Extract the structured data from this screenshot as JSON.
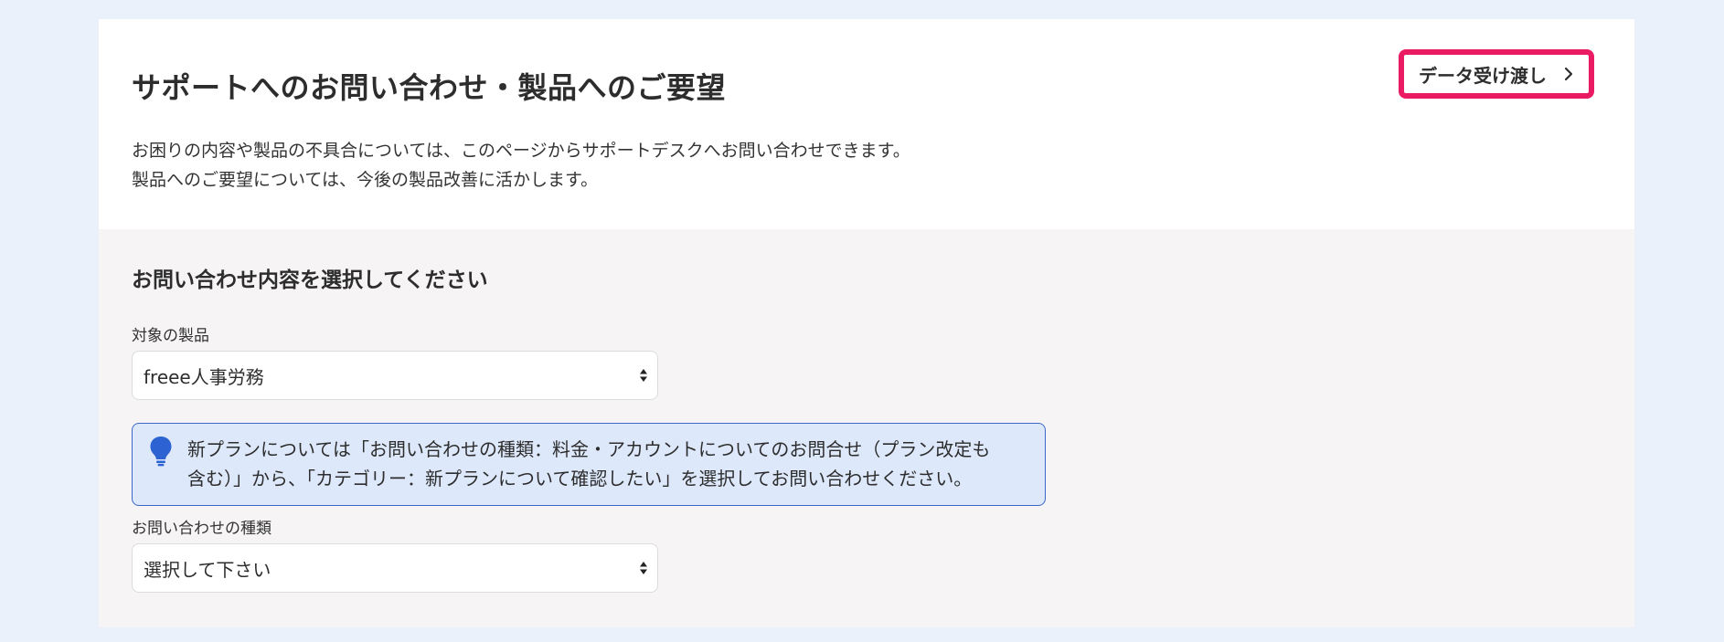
{
  "header": {
    "title": "サポートへのお問い合わせ・製品へのご要望",
    "handoff_button_label": "データ受け渡し",
    "intro_lines": [
      "お困りの内容や製品の不具合については、このページからサポートデスクへお問い合わせできます。",
      "製品へのご要望については、今後の製品改善に活かします。"
    ]
  },
  "form": {
    "section_title": "お問い合わせ内容を選択してください",
    "product": {
      "label": "対象の製品",
      "value": "freee人事労務"
    },
    "notice": {
      "icon": "lightbulb-icon",
      "lines": [
        "新プランについては「お問い合わせの種類：料金・アカウントについてのお問合せ（プラン改定も",
        "含む）」から、「カテゴリー：新プランについて確認したい」を選択してお問い合わせください。"
      ]
    },
    "inquiry_type": {
      "label": "お問い合わせの種類",
      "value": "選択して下さい"
    }
  },
  "colors": {
    "page_background": "#eaf1fb",
    "form_background": "#f6f4f4",
    "highlight_border": "#eb1b63",
    "notice_background": "#dde8fb",
    "notice_border": "#3d67c6",
    "bulb": "#2d62d3"
  }
}
